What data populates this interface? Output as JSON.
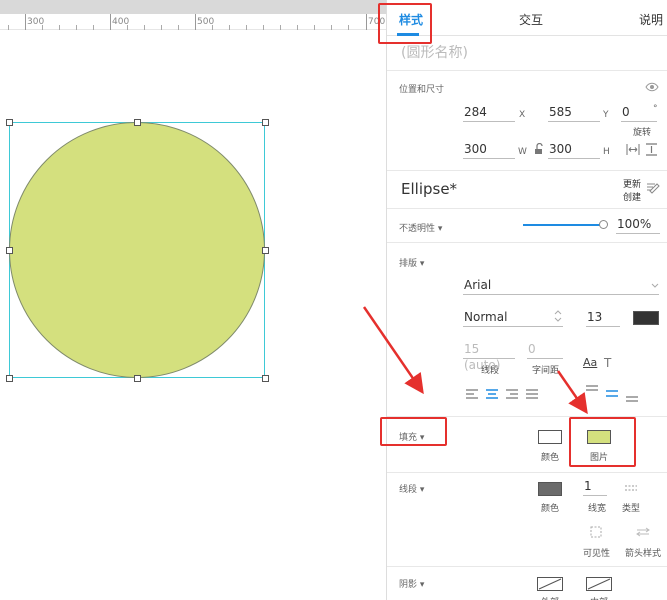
{
  "canvas": {
    "ruler_labels": [
      "300",
      "400",
      "500",
      "700"
    ],
    "ellipse_fill": "#d4e07e",
    "ellipse_stroke": "#7f8a6b",
    "selection_color": "#3ec9d6"
  },
  "panel": {
    "tabs": {
      "style": "样式",
      "interaction": "交互",
      "notes": "说明"
    },
    "shape_name_placeholder": "(圆形名称)",
    "position_size": {
      "label": "位置和尺寸",
      "x": "284",
      "x_unit": "X",
      "y": "585",
      "y_unit": "Y",
      "rotation": "0",
      "rotation_unit": "°",
      "rotation_label": "旋转",
      "width": "300",
      "width_unit": "W",
      "height": "300",
      "height_unit": "H"
    },
    "style_name": "Ellipse*",
    "style_update": "更新",
    "style_create": "创建",
    "opacity": {
      "label": "不透明性 ▾",
      "value": "100%",
      "level": 1.0
    },
    "typography": {
      "label": "排版 ▾",
      "font": "Arial",
      "weight": "Normal",
      "size": "13",
      "text_color": "#333333",
      "line_spacing": "15 (auto)",
      "line_spacing_label": "线段",
      "char_spacing": "0",
      "char_spacing_label": "字间距",
      "aa_glyph": "Aa",
      "t_glyph": "T"
    },
    "fill": {
      "label": "填充 ▾",
      "color_label": "颜色",
      "color_value": "#ffffff",
      "image_label": "图片",
      "image_value": "#d4e07e"
    },
    "stroke": {
      "label": "线段 ▾",
      "color_label": "颜色",
      "color_value": "#6b6b6b",
      "width": "1",
      "width_label": "线宽",
      "type_label": "类型",
      "visibility_label": "可见性",
      "arrow_label": "箭头样式"
    },
    "shadow": {
      "label": "阴影 ▾",
      "outer_label": "外部",
      "inner_label": "内部"
    }
  },
  "accent": "#1e8be2",
  "annotation_red": "#e5302d"
}
